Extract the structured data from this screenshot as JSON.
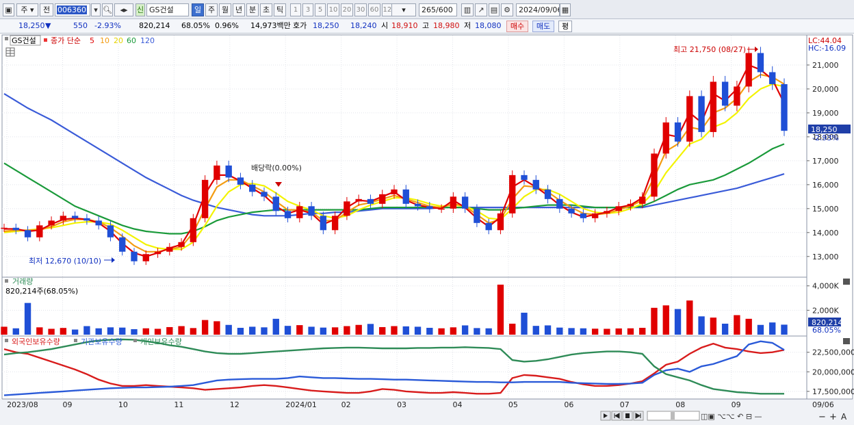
{
  "toolbar": {
    "type_label": "주",
    "scope_label": "전",
    "stock_code": "006360",
    "badge_label": "신",
    "stock_name": "GS건설",
    "periods": [
      "일",
      "주",
      "월",
      "년",
      "분",
      "초",
      "틱"
    ],
    "active_period": "일",
    "intervals": [
      "1",
      "3",
      "5",
      "10",
      "20",
      "30",
      "60",
      "120"
    ],
    "count_display": "265",
    "count_max": "/600",
    "date": "2024/09/06"
  },
  "quote": {
    "price": "18,250",
    "change_arrow": "▼",
    "change": "550",
    "change_rate": "-2.93%",
    "volume": "820,214",
    "volume_rate": "68.05%",
    "turnover_rate": "0.96%",
    "amount": "14,973백만",
    "hoga_label": "호가",
    "ask": "18,250",
    "bid": "18,240",
    "open_label": "시",
    "open": "18,910",
    "high_label": "고",
    "high": "18,980",
    "low_label": "저",
    "low": "18,080",
    "buy_label": "매수",
    "sell_label": "매도",
    "eval_label": "평"
  },
  "legend": {
    "stock_name": "GS건설",
    "price_label": "종가 단순",
    "ma_labels": [
      "5",
      "10",
      "20",
      "60",
      "120"
    ]
  },
  "colors": {
    "candle_up": "#e00000",
    "candle_down": "#1f4fd6",
    "ma5": "#e00000",
    "ma10": "#f39c12",
    "ma20": "#f3f300",
    "ma60": "#1a9a3a",
    "ma120": "#3a5bd8",
    "foreign": "#d81c1c",
    "institution": "#2a5ad8",
    "individual": "#2e8b57"
  },
  "annotations": {
    "high": "최고 21,750 (08/27)",
    "low": "최저 12,670 (10/10)",
    "dividend": "배당락(0.00%)"
  },
  "right_labels": {
    "lc": "LC:44.04",
    "hc": "HC:-16.09",
    "price_box": "18,250",
    "change_rate": "-2.93%",
    "volume_box": "820,214",
    "volume_rate": "68.05%"
  },
  "volume_panel": {
    "title": "거래량",
    "value": "820,214주(68.05%)"
  },
  "holdings_panel": {
    "title_foreign": "외국인보유수량",
    "title_institution": "기관보유수량",
    "title_individual": "개인보유수량"
  },
  "x_axis": {
    "labels": [
      "2023/08",
      "09",
      "10",
      "11",
      "12",
      "2024/01",
      "02",
      "03",
      "04",
      "05",
      "06",
      "07",
      "08",
      "09"
    ],
    "right_label": "09/06"
  },
  "chart_data": [
    {
      "type": "candlestick",
      "title": "GS건설",
      "y_ticks": [
        13000,
        14000,
        15000,
        16000,
        17000,
        18000,
        19000,
        20000,
        21000
      ],
      "y_tick_labels": [
        "13,000",
        "14,000",
        "15,000",
        "16,000",
        "17,000",
        "18,000",
        "19,000",
        "20,000",
        "21,000"
      ],
      "ylim": [
        12250,
        22200
      ],
      "x": [
        "2023/08",
        "09",
        "10",
        "11",
        "12",
        "2024/01",
        "02",
        "03",
        "04",
        "05",
        "06",
        "07",
        "08",
        "09"
      ],
      "series": [
        {
          "name": "종가",
          "values": [
            14200,
            14100,
            13800,
            14300,
            14500,
            14700,
            14600,
            14500,
            14300,
            13800,
            13200,
            12800,
            13100,
            13200,
            13400,
            13600,
            14600,
            16200,
            16800,
            16300,
            16000,
            15700,
            15500,
            14900,
            14600,
            15100,
            14700,
            14100,
            14700,
            15300,
            15400,
            15200,
            15600,
            15800,
            15200,
            15100,
            15000,
            15000,
            15500,
            15000,
            14400,
            14100,
            14800,
            16400,
            16200,
            15800,
            15400,
            15000,
            14800,
            14600,
            14800,
            14900,
            15100,
            15200,
            15500,
            17300,
            18600,
            17800,
            19700,
            18200,
            20300,
            19300,
            20100,
            21500,
            20700,
            20200,
            18250
          ]
        },
        {
          "name": "5",
          "values": [
            14150,
            14150,
            14050,
            14100,
            14350,
            14550,
            14600,
            14550,
            14400,
            14050,
            13550,
            13150,
            13000,
            13150,
            13350,
            13500,
            14300,
            15600,
            16400,
            16400,
            16150,
            15850,
            15550,
            15100,
            14800,
            14950,
            14800,
            14350,
            14550,
            15050,
            15350,
            15300,
            15500,
            15700,
            15350,
            15150,
            15050,
            15000,
            15350,
            15050,
            14600,
            14250,
            14650,
            15900,
            16200,
            15900,
            15550,
            15150,
            14850,
            14650,
            14750,
            14850,
            15050,
            15150,
            15450,
            16800,
            18100,
            18000,
            19000,
            18600,
            19800,
            19500,
            20000,
            21000,
            20800,
            20400,
            19400
          ]
        },
        {
          "name": "10",
          "values": [
            14050,
            14100,
            14100,
            14100,
            14250,
            14450,
            14550,
            14550,
            14450,
            14200,
            13850,
            13450,
            13200,
            13200,
            13300,
            13400,
            14000,
            15000,
            15900,
            16200,
            16200,
            15950,
            15700,
            15300,
            14950,
            14950,
            14850,
            14500,
            14500,
            14850,
            15150,
            15250,
            15400,
            15550,
            15400,
            15250,
            15100,
            15050,
            15200,
            15100,
            14750,
            14400,
            14550,
            15400,
            15950,
            15900,
            15700,
            15350,
            15050,
            14800,
            14750,
            14800,
            14950,
            15100,
            15350,
            16300,
            17400,
            17700,
            18400,
            18300,
            19000,
            19200,
            19600,
            20300,
            20600,
            20500,
            20200
          ]
        },
        {
          "name": "20",
          "values": [
            14000,
            14050,
            14100,
            14150,
            14200,
            14300,
            14400,
            14450,
            14450,
            14350,
            14100,
            13800,
            13500,
            13350,
            13300,
            13300,
            13600,
            14300,
            15100,
            15700,
            16000,
            16050,
            15950,
            15650,
            15300,
            15100,
            14950,
            14700,
            14600,
            14700,
            14950,
            15150,
            15300,
            15450,
            15450,
            15350,
            15200,
            15100,
            15150,
            15100,
            14900,
            14600,
            14550,
            15000,
            15500,
            15800,
            15800,
            15600,
            15300,
            15000,
            14850,
            14800,
            14850,
            15000,
            15200,
            15700,
            16500,
            17100,
            17700,
            17900,
            18400,
            18600,
            19000,
            19600,
            20000,
            20200,
            20100
          ]
        },
        {
          "name": "60",
          "values": [
            16900,
            16600,
            16300,
            16000,
            15700,
            15400,
            15100,
            14900,
            14700,
            14500,
            14300,
            14150,
            14050,
            14000,
            13950,
            13950,
            14050,
            14250,
            14500,
            14650,
            14750,
            14850,
            14900,
            14950,
            14950,
            14950,
            14950,
            14950,
            14950,
            14950,
            14950,
            15000,
            15050,
            15050,
            15050,
            15050,
            15050,
            15050,
            15050,
            15050,
            15000,
            14950,
            14950,
            15000,
            15050,
            15100,
            15150,
            15150,
            15150,
            15100,
            15050,
            15050,
            15050,
            15050,
            15100,
            15300,
            15550,
            15800,
            16000,
            16100,
            16200,
            16400,
            16650,
            16900,
            17200,
            17500,
            17700
          ]
        },
        {
          "name": "120",
          "values": [
            19800,
            19500,
            19200,
            18950,
            18700,
            18400,
            18100,
            17800,
            17500,
            17200,
            16900,
            16600,
            16300,
            16050,
            15800,
            15550,
            15350,
            15200,
            15050,
            14950,
            14850,
            14750,
            14700,
            14700,
            14700,
            14750,
            14800,
            14800,
            14850,
            14850,
            14900,
            14950,
            15000,
            15000,
            15000,
            15000,
            15000,
            15050,
            15050,
            15050,
            15050,
            15050,
            15050,
            15050,
            15050,
            15050,
            15050,
            15050,
            15050,
            15050,
            15050,
            15050,
            15050,
            15050,
            15050,
            15150,
            15250,
            15350,
            15450,
            15550,
            15650,
            15750,
            15850,
            16000,
            16150,
            16300,
            16450
          ]
        }
      ]
    },
    {
      "type": "bar",
      "title": "거래량",
      "y_ticks": [
        2000,
        4000
      ],
      "y_tick_labels": [
        "2,000K",
        "4,000K"
      ],
      "ylim": [
        0,
        4600
      ],
      "values": [
        650,
        520,
        2600,
        600,
        480,
        550,
        420,
        700,
        520,
        600,
        580,
        450,
        520,
        480,
        620,
        700,
        540,
        1200,
        1100,
        800,
        560,
        650,
        600,
        1300,
        720,
        780,
        650,
        580,
        600,
        700,
        800,
        880,
        620,
        700,
        680,
        650,
        560,
        520,
        600,
        760,
        540,
        520,
        4100,
        900,
        1800,
        720,
        760,
        580,
        540,
        520,
        490,
        480,
        510,
        520,
        560,
        2200,
        2400,
        2100,
        2800,
        1500,
        1400,
        900,
        1600,
        1300,
        800,
        1000,
        820
      ]
    },
    {
      "type": "line",
      "title": "보유수량",
      "y_ticks": [
        17500000,
        20000000,
        22500000
      ],
      "y_tick_labels": [
        "17,500,000",
        "20,000,000",
        "22,500,000"
      ],
      "ylim": [
        16700000,
        24400000
      ],
      "series": [
        {
          "name": "외국인보유수량",
          "values": [
            22900000,
            22500000,
            22300000,
            21800000,
            21300000,
            20800000,
            20300000,
            19700000,
            19000000,
            18500000,
            18200000,
            18200000,
            18300000,
            18200000,
            18100000,
            18000000,
            17900000,
            17700000,
            17800000,
            17900000,
            18000000,
            18200000,
            18300000,
            18200000,
            18000000,
            17800000,
            17600000,
            17500000,
            17400000,
            17300000,
            17300000,
            17500000,
            17800000,
            17700000,
            17500000,
            17400000,
            17300000,
            17300000,
            17400000,
            17300000,
            17200000,
            17200000,
            17300000,
            19200000,
            19600000,
            19500000,
            19300000,
            19100000,
            18700000,
            18400000,
            18200000,
            18200000,
            18300000,
            18500000,
            18800000,
            19800000,
            20900000,
            21300000,
            22300000,
            23100000,
            23600000,
            23100000,
            22900000,
            22600000,
            22400000,
            22500000,
            22800000
          ]
        },
        {
          "name": "기관보유수량",
          "values": [
            17000000,
            17100000,
            17200000,
            17300000,
            17400000,
            17500000,
            17600000,
            17700000,
            17800000,
            17900000,
            17950000,
            18000000,
            18000000,
            18050000,
            18100000,
            18200000,
            18300000,
            18600000,
            18900000,
            19000000,
            19050000,
            19100000,
            19100000,
            19100000,
            19200000,
            19400000,
            19300000,
            19200000,
            19200000,
            19150000,
            19100000,
            19100000,
            19050000,
            19000000,
            19000000,
            18950000,
            18900000,
            18850000,
            18800000,
            18750000,
            18700000,
            18700000,
            18650000,
            18650000,
            18700000,
            18700000,
            18700000,
            18700000,
            18600000,
            18550000,
            18500000,
            18450000,
            18450000,
            18500000,
            18600000,
            19600000,
            20200000,
            20400000,
            20000000,
            20700000,
            21000000,
            21500000,
            22000000,
            23500000,
            23900000,
            23700000,
            22800000
          ]
        },
        {
          "name": "개인보유수량",
          "values": [
            22200000,
            22400000,
            22500000,
            22700000,
            22900000,
            23200000,
            23500000,
            23800000,
            24000000,
            24100000,
            24150000,
            24100000,
            23900000,
            23700000,
            23400000,
            23200000,
            22900000,
            22600000,
            22400000,
            22300000,
            22300000,
            22400000,
            22500000,
            22600000,
            22700000,
            22800000,
            22900000,
            23000000,
            23050000,
            23100000,
            23100000,
            23050000,
            23000000,
            23000000,
            23000000,
            23050000,
            23050000,
            23100000,
            23100000,
            23150000,
            23100000,
            23050000,
            22900000,
            21500000,
            21300000,
            21400000,
            21600000,
            21900000,
            22200000,
            22400000,
            22500000,
            22600000,
            22600000,
            22500000,
            22300000,
            20700000,
            19700000,
            19300000,
            18900000,
            18300000,
            17800000,
            17600000,
            17400000,
            17300000,
            17200000,
            17200000,
            17200000
          ]
        }
      ]
    }
  ]
}
